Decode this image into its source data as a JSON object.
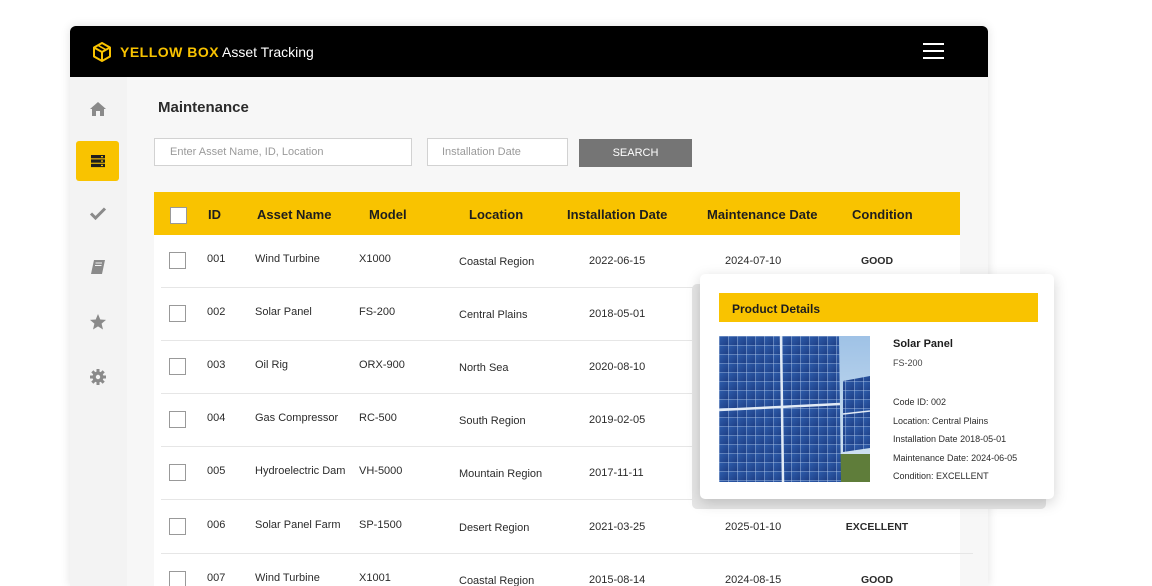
{
  "header": {
    "brand": "YELLOW BOX",
    "app_name": "Asset Tracking",
    "brand_color": "#f9c300"
  },
  "sidebar": {
    "items": [
      {
        "name": "home",
        "icon": "home-icon",
        "active": false
      },
      {
        "name": "assets",
        "icon": "server-icon",
        "active": true
      },
      {
        "name": "tasks",
        "icon": "check-icon",
        "active": false
      },
      {
        "name": "docs",
        "icon": "book-icon",
        "active": false
      },
      {
        "name": "favorites",
        "icon": "star-icon",
        "active": false
      },
      {
        "name": "settings",
        "icon": "gear-icon",
        "active": false
      }
    ]
  },
  "main": {
    "title": "Maintenance",
    "search_placeholder": "Enter Asset Name, ID, Location",
    "date_placeholder": "Installation Date",
    "search_label": "SEARCH"
  },
  "table": {
    "headers": [
      "ID",
      "Asset Name",
      "Model",
      "Location",
      "Installation Date",
      "Maintenance Date",
      "Condition"
    ],
    "rows": [
      {
        "id": "001",
        "name": "Wind Turbine",
        "model": "X1000",
        "location": "Coastal Region",
        "install": "2022-06-15",
        "maint": "2024-07-10",
        "cond": "GOOD"
      },
      {
        "id": "002",
        "name": "Solar Panel",
        "model": "FS-200",
        "location": "Central Plains",
        "install": "2018-05-01",
        "maint": "",
        "cond": ""
      },
      {
        "id": "003",
        "name": "Oil Rig",
        "model": "ORX-900",
        "location": "North Sea",
        "install": "2020-08-10",
        "maint": "",
        "cond": ""
      },
      {
        "id": "004",
        "name": "Gas Compressor",
        "model": "RC-500",
        "location": "South Region",
        "install": "2019-02-05",
        "maint": "",
        "cond": ""
      },
      {
        "id": "005",
        "name": "Hydroelectric Dam",
        "model": "VH-5000",
        "location": "Mountain Region",
        "install": "2017-11-11",
        "maint": "",
        "cond": ""
      },
      {
        "id": "006",
        "name": "Solar Panel Farm",
        "model": "SP-1500",
        "location": "Desert Region",
        "install": "2021-03-25",
        "maint": "2025-01-10",
        "cond": "EXCELLENT"
      },
      {
        "id": "007",
        "name": "Wind Turbine",
        "model": "X1001",
        "location": "Coastal Region",
        "install": "2015-08-14",
        "maint": "2024-08-15",
        "cond": "GOOD"
      }
    ]
  },
  "popup": {
    "title": "Product Details",
    "name": "Solar Panel",
    "model": "FS-200",
    "code_label": "Code ID:",
    "code_value": "002",
    "location_label": "Location:",
    "location_value": "Central Plains",
    "install_label": "Installation Date",
    "install_value": "2018-05-01",
    "maint_label": "Maintenance Date:",
    "maint_value": "2024-06-05",
    "cond_label": "Condition:",
    "cond_value": "EXCELLENT"
  }
}
